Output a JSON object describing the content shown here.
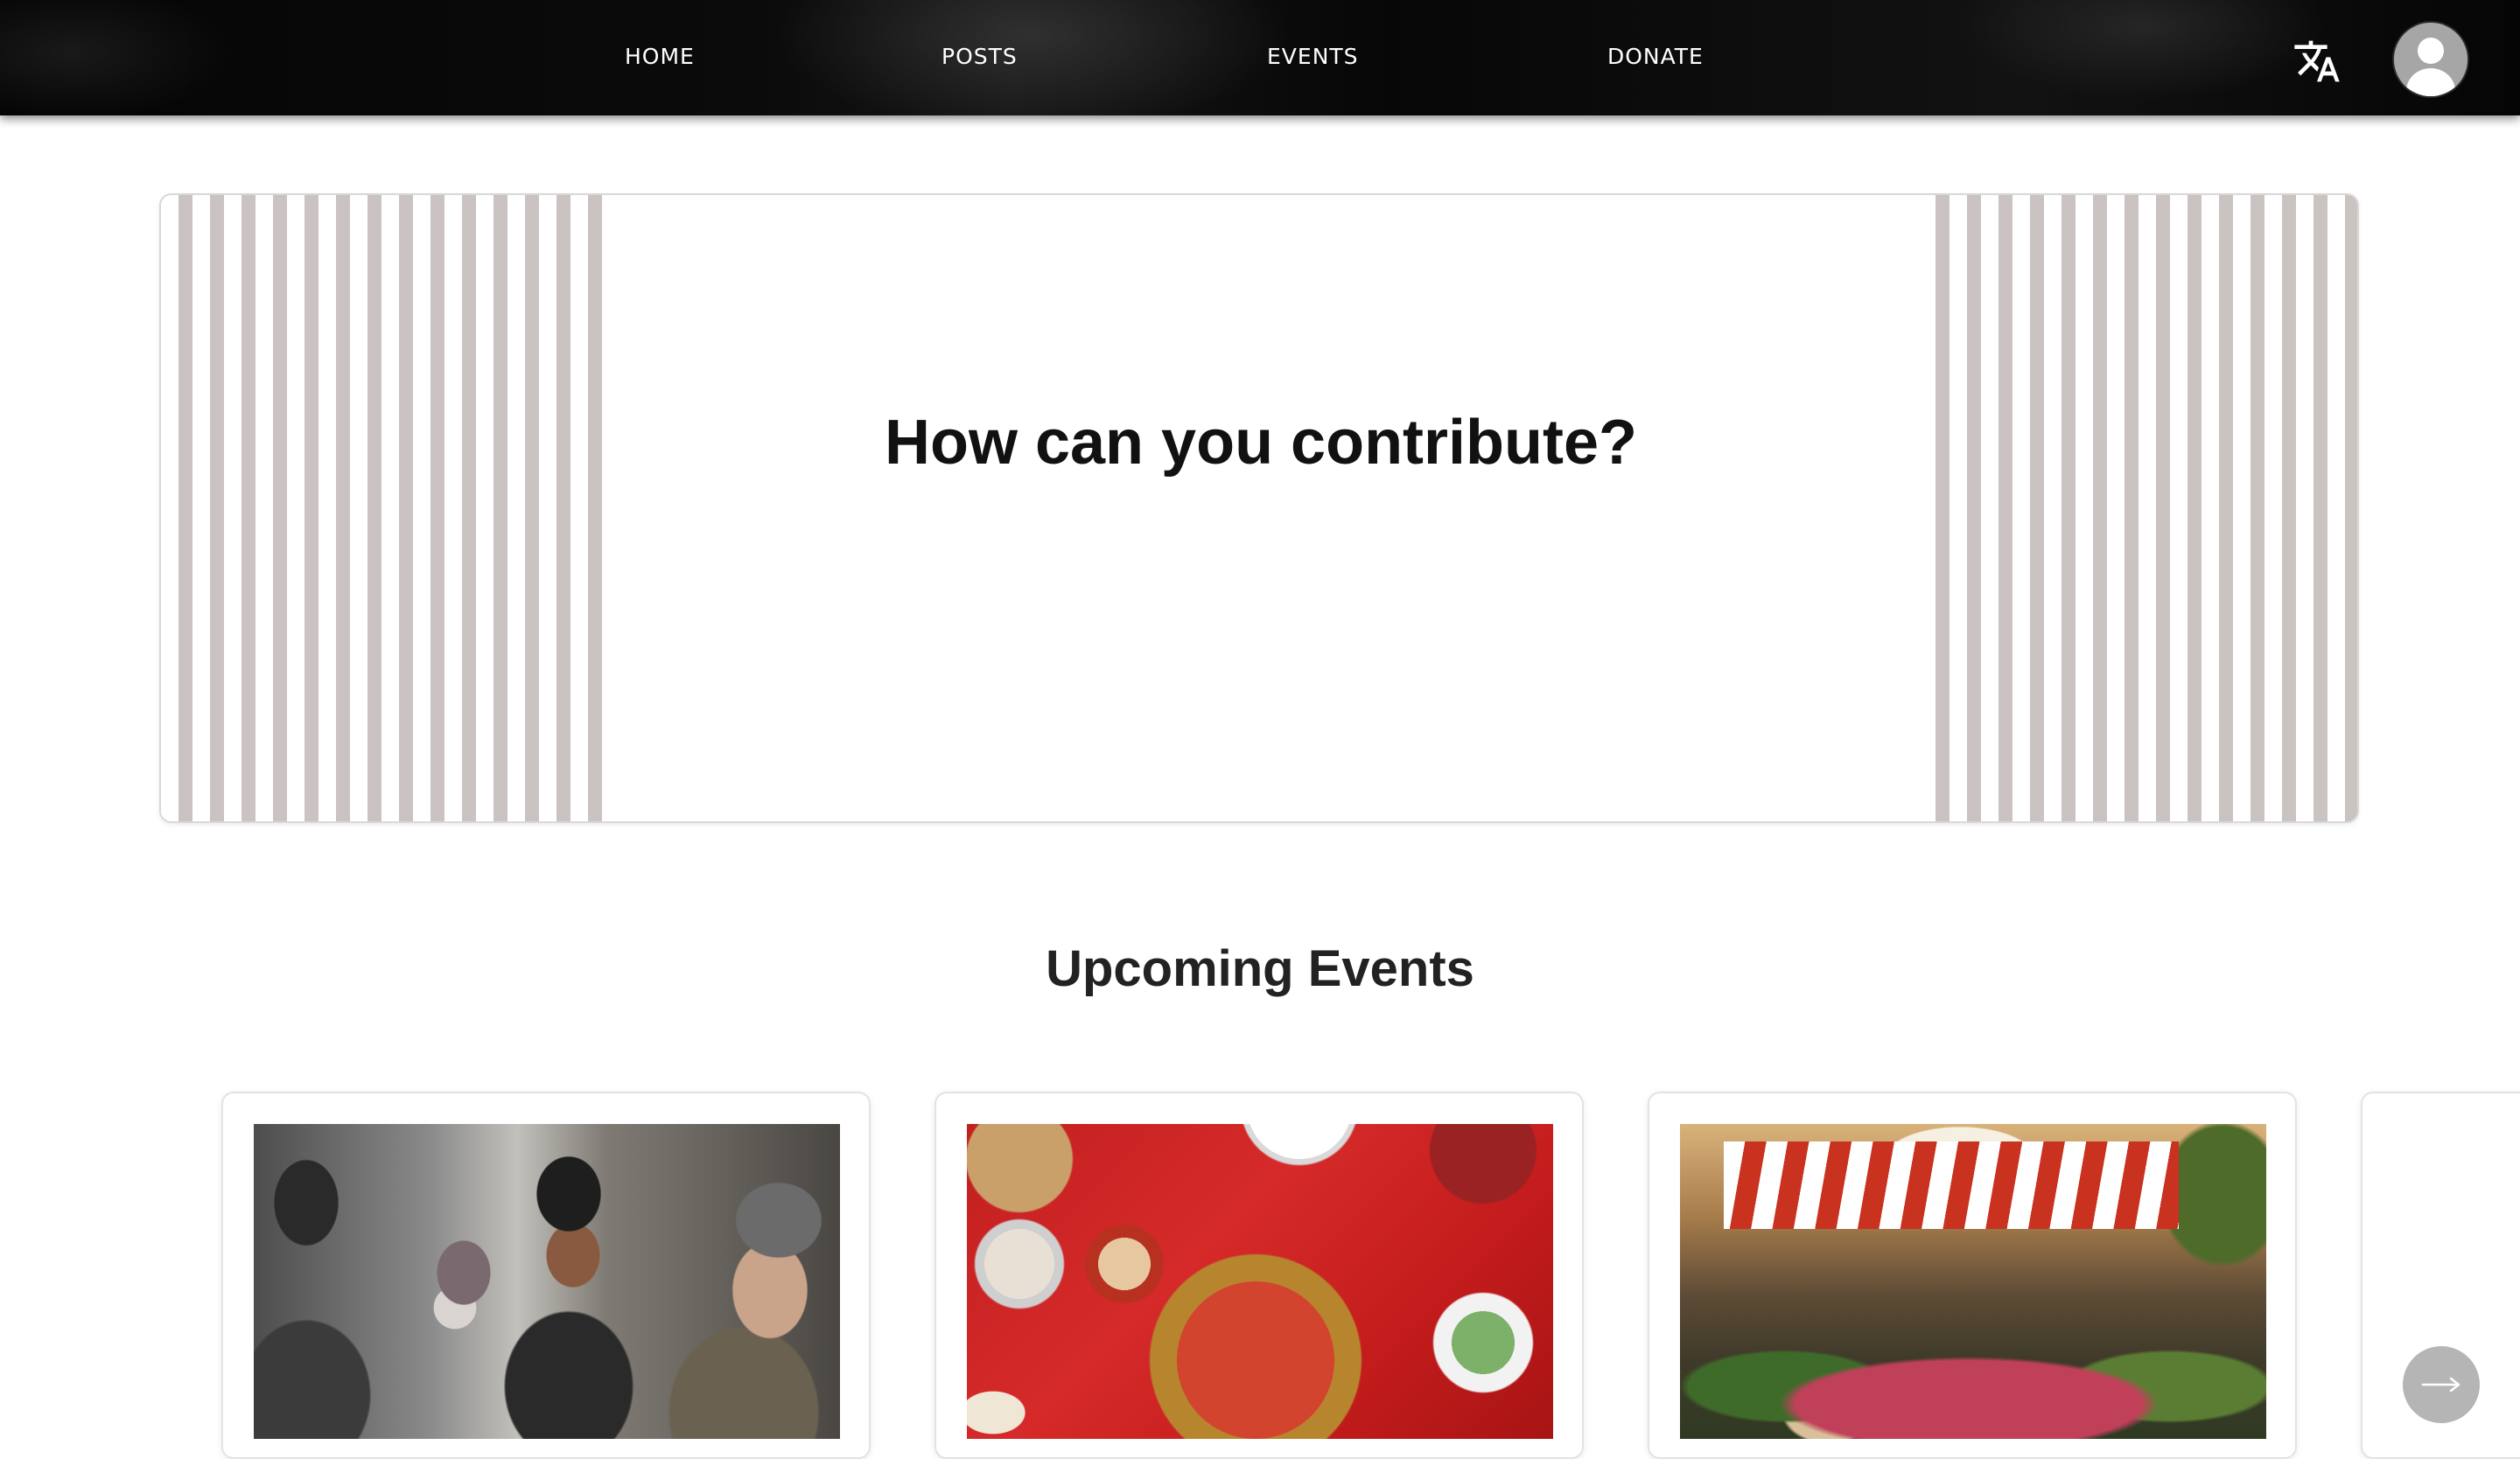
{
  "nav": {
    "links": [
      {
        "label": "HOME"
      },
      {
        "label": "POSTS"
      },
      {
        "label": "EVENTS"
      },
      {
        "label": "DONATE"
      }
    ],
    "translate_icon": "translate-icon",
    "avatar_icon": "user-avatar-icon"
  },
  "hero": {
    "title": "How can you contribute?"
  },
  "events": {
    "title": "Upcoming Events",
    "cards": [
      {
        "image": "volunteers-serving-food-photo"
      },
      {
        "image": "red-table-feast-photo"
      },
      {
        "image": "outdoor-flower-market-photo"
      }
    ],
    "next_icon": "arrow-right-icon"
  },
  "colors": {
    "nav_background": "#0b0b0b",
    "nav_text": "#ffffff",
    "stripe": "#cbc2c2",
    "heading_text": "#111111",
    "arrow_button": "#8f8f8f"
  }
}
